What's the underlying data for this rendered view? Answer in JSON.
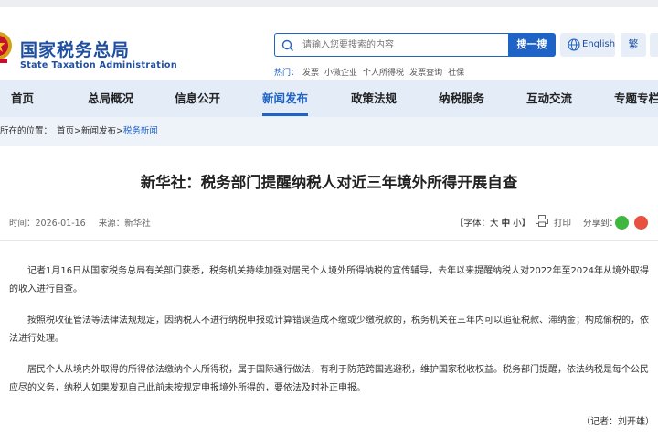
{
  "header": {
    "site_name_cn": "国家税务总局",
    "site_name_en": "State Taxation Administration",
    "search": {
      "placeholder": "请输入您要搜索的内容",
      "button_label": "搜一搜"
    },
    "english_label": "English",
    "traditional_label": "繁",
    "hot_label": "热门：",
    "hot_links": [
      "发票",
      "小微企业",
      "个人所得税",
      "发票查询",
      "社保"
    ]
  },
  "nav": {
    "items": [
      "首页",
      "总局概况",
      "信息公开",
      "新闻发布",
      "政策法规",
      "纳税服务",
      "互动交流",
      "专题专栏"
    ],
    "active": "新闻发布"
  },
  "breadcrumb": {
    "label": "所在的位置：",
    "path": "首页>新闻发布>",
    "current": "税务新闻"
  },
  "article": {
    "title": "新华社：税务部门提醒纳税人对近三年境外所得开展自查",
    "time": "时间：2026-01-16",
    "source": "来源：新华社",
    "font_size_prefix": "【字体：",
    "font_large": "大",
    "font_medium": "中",
    "font_small": "小",
    "font_size_suffix": "】",
    "print": "打印",
    "share": "分享到：",
    "paragraphs": [
      "记者1月16日从国家税务总局有关部门获悉，税务机关持续加强对居民个人境外所得纳税的宣传辅导，去年以来提醒纳税人对2022年至2024年从境外取得的收入进行自查。",
      "按照税收征管法等法律法规规定，因纳税人不进行纳税申报或计算错误造成不缴或少缴税款的，税务机关在三年内可以追征税款、滞纳金；构成偷税的，依法进行处理。",
      "居民个人从境内外取得的所得依法缴纳个人所得税，属于国际通行做法，有利于防范跨国逃避税，维护国家税收权益。税务部门提醒，依法纳税是每个公民应尽的义务，纳税人如果发现自己此前未按规定申报境外所得的，要依法及时补正申报。"
    ],
    "reporter": "（记者：刘开雄）"
  },
  "colors": {
    "brand_blue": "#1f4fa0",
    "accent_blue": "#1f63c6",
    "nav_bg": "#e4ecf8"
  }
}
